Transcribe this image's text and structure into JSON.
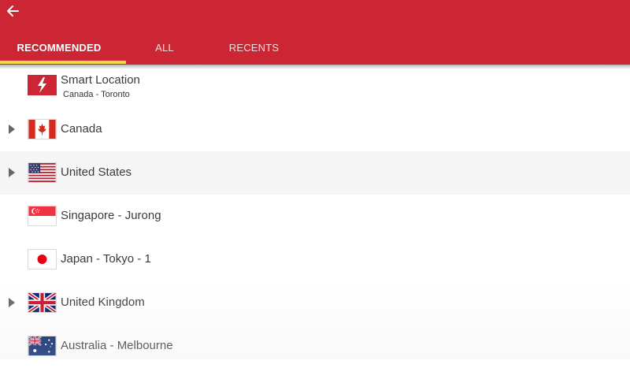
{
  "colors": {
    "accent": "#cc2634",
    "tab_indicator": "#f3d546"
  },
  "toolbar": {
    "back_icon": "arrow-left-icon"
  },
  "tabs": [
    {
      "label": "RECOMMENDED",
      "active": true
    },
    {
      "label": "ALL",
      "active": false
    },
    {
      "label": "RECENTS",
      "active": false
    }
  ],
  "locations": [
    {
      "name": "Smart Location",
      "subtitle": "Canada - Toronto",
      "icon": "lightning-icon",
      "expandable": false
    },
    {
      "name": "Canada",
      "icon": "canada-flag-icon",
      "expandable": true
    },
    {
      "name": "United States",
      "icon": "us-flag-icon",
      "expandable": true
    },
    {
      "name": "Singapore - Jurong",
      "icon": "singapore-flag-icon",
      "expandable": false
    },
    {
      "name": "Japan - Tokyo - 1",
      "icon": "japan-flag-icon",
      "expandable": false
    },
    {
      "name": "United Kingdom",
      "icon": "uk-flag-icon",
      "expandable": true
    },
    {
      "name": "Australia - Melbourne",
      "icon": "australia-flag-icon",
      "expandable": false
    }
  ]
}
